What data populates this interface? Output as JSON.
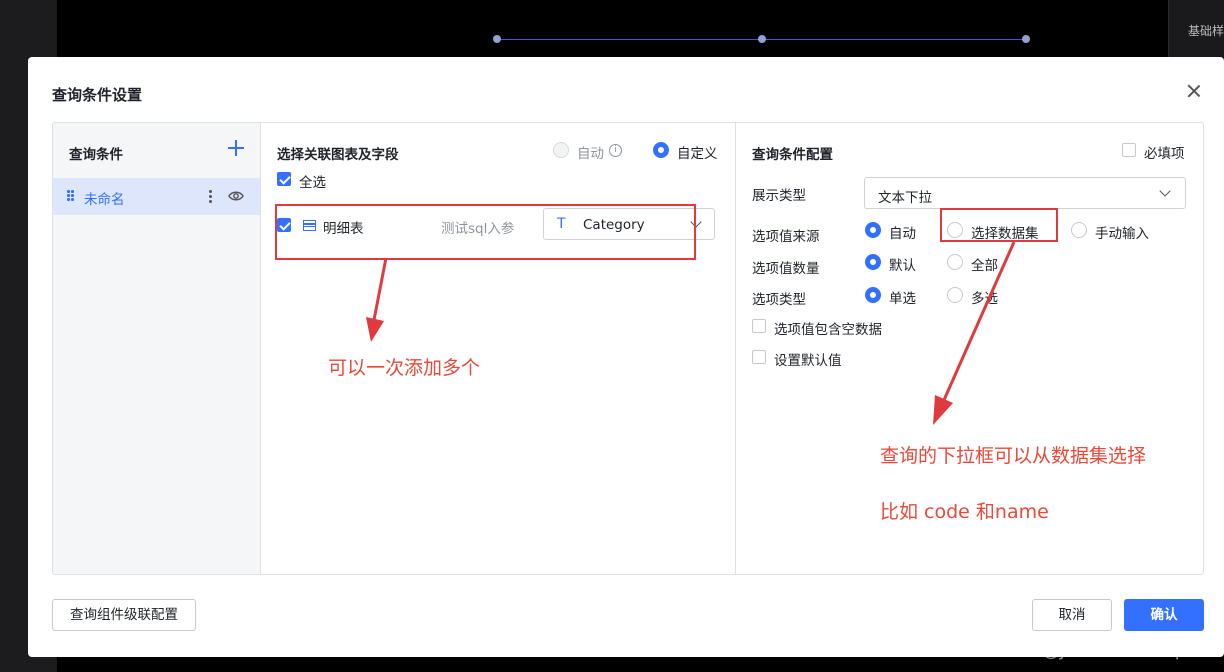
{
  "background": {
    "sidebar_label": "基础样"
  },
  "dialog": {
    "title": "查询条件设置",
    "panel1": {
      "header": "查询条件",
      "items": [
        {
          "label": "未命名"
        }
      ]
    },
    "panel2": {
      "header": "选择关联图表及字段",
      "mode_options": [
        {
          "label": "自动",
          "checked": false,
          "disabled": true
        },
        {
          "label": "自定义",
          "checked": true,
          "disabled": false
        }
      ],
      "select_all": {
        "label": "全选",
        "checked": true
      },
      "rows": [
        {
          "checked": true,
          "chart_name": "明细表",
          "dataset": "测试sql入参",
          "field": "Category"
        }
      ]
    },
    "panel3": {
      "header": "查询条件配置",
      "required": {
        "label": "必填项",
        "checked": false
      },
      "display_type": {
        "label": "展示类型",
        "value": "文本下拉"
      },
      "option_source": {
        "label": "选项值来源",
        "options": [
          {
            "label": "自动",
            "checked": true
          },
          {
            "label": "选择数据集",
            "checked": false
          },
          {
            "label": "手动输入",
            "checked": false
          }
        ]
      },
      "option_count": {
        "label": "选项值数量",
        "options": [
          {
            "label": "默认",
            "checked": true
          },
          {
            "label": "全部",
            "checked": false
          }
        ]
      },
      "option_type": {
        "label": "选项类型",
        "options": [
          {
            "label": "单选",
            "checked": true
          },
          {
            "label": "多选",
            "checked": false
          }
        ]
      },
      "include_empty": {
        "label": "选项值包含空数据",
        "checked": false
      },
      "set_default": {
        "label": "设置默认值",
        "checked": false
      }
    },
    "footer": {
      "cascade_button": "查询组件级联配置",
      "cancel_button": "取消",
      "confirm_button": "确认"
    }
  },
  "annotations": {
    "note1": "可以一次添加多个",
    "note2": "查询的下拉框可以从数据集选择",
    "note3": "比如 code 和name",
    "color": "#e84a3a"
  },
  "watermark": "CSDN @Java&Develop",
  "colors": {
    "accent": "#3370ff",
    "annotation_red": "#e0393e"
  }
}
